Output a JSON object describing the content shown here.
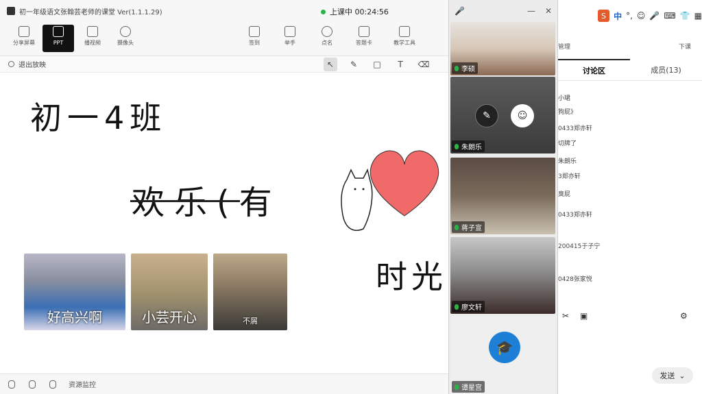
{
  "window": {
    "title": "初一年级语文张翰芸老师的课堂 Ver(1.1.1.29)",
    "live_text": "上课中 00:24:56"
  },
  "toolbar": {
    "share_screen": "分享屏幕",
    "ppt": "PPT",
    "video": "播视频",
    "camera": "摄像头",
    "signin": "签到",
    "raise_hand": "举手",
    "rollcall": "点名",
    "answer_card": "答题卡",
    "teaching_tools": "教学工具"
  },
  "subbar": {
    "exit_play": "退出放映"
  },
  "slide": {
    "line1": "初一4班",
    "line2": "欢乐(有",
    "line3": "时光",
    "photo1_caption": "好高兴啊",
    "photo2_caption": "小芸开心",
    "photo3_caption": "不屑"
  },
  "statusbar": {
    "resource_monitor": "资源监控"
  },
  "video_tiles": [
    {
      "name": "李硕"
    },
    {
      "name": "朱朗乐"
    },
    {
      "name": "蒋子宣"
    },
    {
      "name": "廖文轩"
    },
    {
      "name": "谭星宫"
    }
  ],
  "ime": {
    "mode": "中"
  },
  "side": {
    "manage_label": "管理",
    "download_label": "下课",
    "tab_discussion": "讨论区",
    "tab_members": "成员(13)",
    "chat_lines": [
      "小珺",
      "狗屁》",
      "0433郑亦轩",
      "切牌了",
      "朱朗乐",
      "3郑亦轩",
      "臭屁",
      "0433郑亦轩",
      "200415于子宁",
      "0428张家悦"
    ],
    "send": "发送"
  }
}
